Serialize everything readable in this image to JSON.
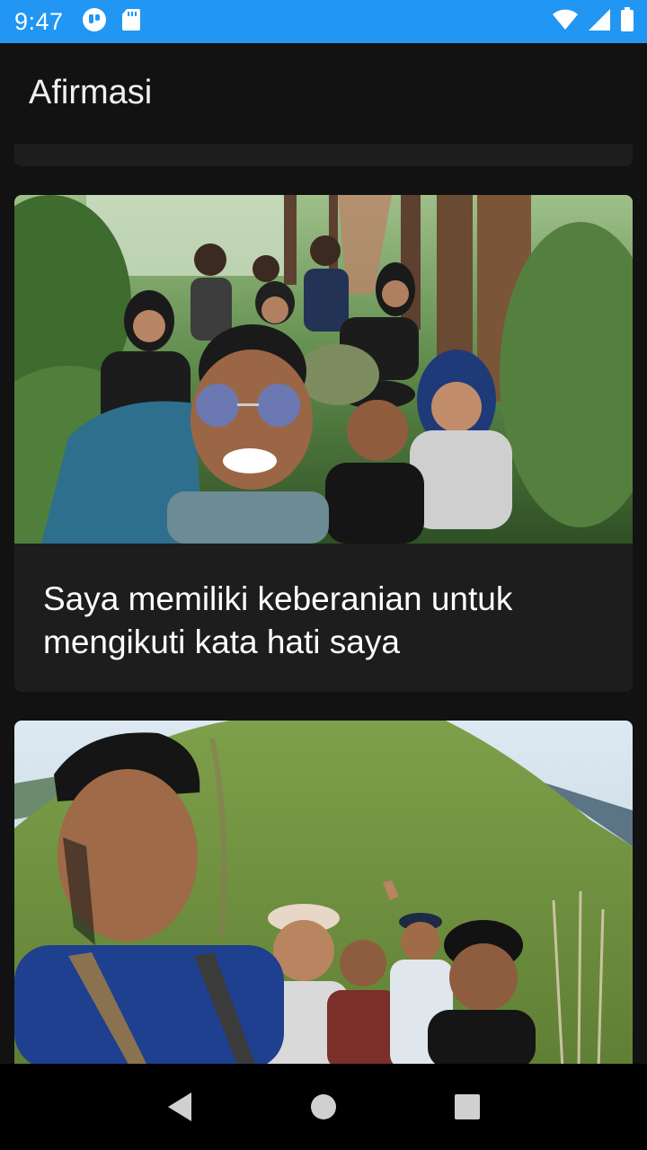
{
  "status_bar": {
    "time": "9:47",
    "left_icons": [
      "notification-app-icon",
      "sd-card-icon"
    ],
    "right_icons": [
      "wifi-icon",
      "cell-signal-icon",
      "battery-icon"
    ],
    "background": "#2196f3"
  },
  "app_bar": {
    "title": "Afirmasi"
  },
  "cards": [
    {
      "image": "group-hiking-selfie-forest",
      "text": "Saya memiliki keberanian untuk mengikuti kata hati saya"
    },
    {
      "image": "group-hiking-selfie-mountain-ridge",
      "text": ""
    }
  ],
  "nav_bar": {
    "buttons": [
      "back-icon",
      "home-icon",
      "recents-icon"
    ]
  }
}
